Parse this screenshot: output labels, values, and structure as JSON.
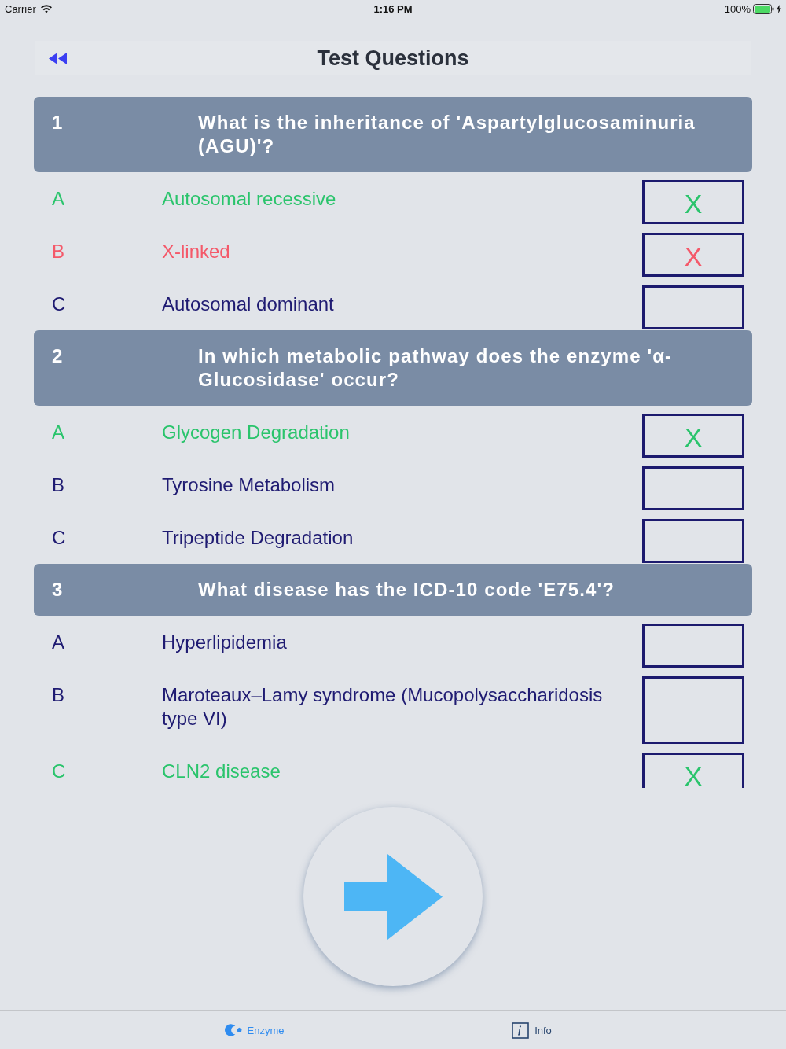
{
  "status_bar": {
    "carrier": "Carrier",
    "time": "1:16 PM",
    "battery": "100%",
    "charging": true
  },
  "nav_bar": {
    "title": "Test Questions"
  },
  "questions": [
    {
      "number": "1",
      "text": "What is the inheritance of 'Aspartylglucosaminuria (AGU)'?",
      "answers": [
        {
          "letter": "A",
          "text": "Autosomal recessive",
          "correct": true,
          "wrong": false,
          "mark": "X"
        },
        {
          "letter": "B",
          "text": "X-linked",
          "correct": false,
          "wrong": true,
          "mark": "X"
        },
        {
          "letter": "C",
          "text": "Autosomal dominant",
          "correct": false,
          "wrong": false
        }
      ]
    },
    {
      "number": "2",
      "text": "In which metabolic pathway does the enzyme 'α-Glucosidase' occur?",
      "answers": [
        {
          "letter": "A",
          "text": "Glycogen Degradation",
          "correct": true,
          "wrong": false,
          "mark": "X"
        },
        {
          "letter": "B",
          "text": "Tyrosine Metabolism",
          "correct": false,
          "wrong": false
        },
        {
          "letter": "C",
          "text": "Tripeptide Degradation",
          "correct": false,
          "wrong": false
        }
      ]
    },
    {
      "number": "3",
      "text": "What disease has the ICD-10 code 'E75.4'?",
      "answers": [
        {
          "letter": "A",
          "text": "Hyperlipidemia",
          "correct": false,
          "wrong": false
        },
        {
          "letter": "B",
          "text": "Maroteaux–Lamy syndrome (Mucopolysaccharidosis type VI)",
          "correct": false,
          "wrong": false
        },
        {
          "letter": "C",
          "text": "CLN2 disease",
          "correct": true,
          "wrong": false,
          "mark": "X"
        }
      ]
    }
  ],
  "tab_bar": {
    "items": [
      {
        "kind": "enzyme",
        "label": "Enzyme",
        "selected": true
      },
      {
        "kind": "info",
        "label": "Info",
        "selected": false
      }
    ]
  }
}
